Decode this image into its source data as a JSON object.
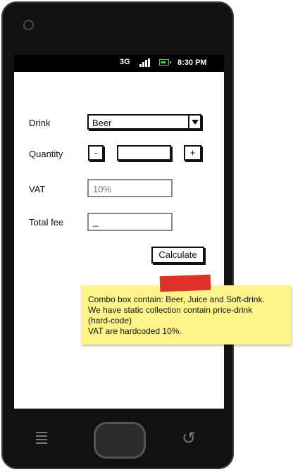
{
  "status_bar": {
    "network": "3G",
    "time": "8:30 PM",
    "signal_icon": "signal-icon",
    "battery_icon": "battery-icon",
    "battery_color": "#3ddc3d"
  },
  "form": {
    "drink_label": "Drink",
    "drink_value": "Beer",
    "quantity_label": "Quantity",
    "minus_label": "-",
    "quantity_value": "",
    "plus_label": "+",
    "vat_label": "VAT",
    "vat_value": "10%",
    "total_label": "Total fee",
    "total_value": "_",
    "calculate_label": "Calculate"
  },
  "note": {
    "lines": [
      "Combo box contain: Beer, Juice and Soft-drink.",
      "We have static collection contain price-drink",
      "(hard-code)",
      "VAT are hardcoded 10%."
    ],
    "background": "#fff58a",
    "tape_color": "#e2312b"
  },
  "nav": {
    "menu_icon": "menu-icon",
    "home_icon": "home-button-icon",
    "back_icon": "back-icon"
  }
}
